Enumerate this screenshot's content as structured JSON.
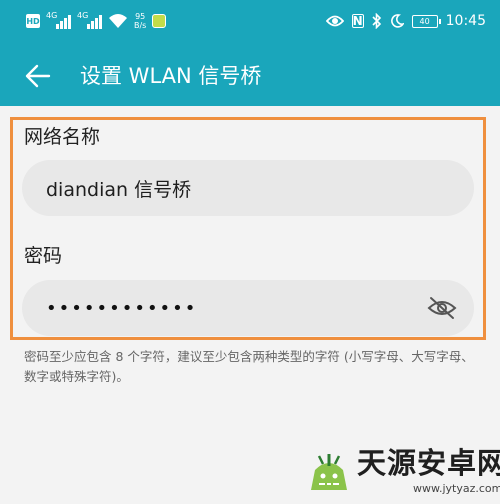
{
  "status_bar": {
    "hd_label": "HD",
    "network_tag_1": "4G",
    "network_tag_2": "4G",
    "speed_value": "95",
    "speed_unit": "B/s",
    "nfc_label": "N",
    "battery_level": "40",
    "time": "10:45"
  },
  "header": {
    "title": "设置 WLAN 信号桥",
    "back_icon": "arrow-left-icon"
  },
  "form": {
    "ssid_label": "网络名称",
    "ssid_value": "diandian 信号桥",
    "password_label": "密码",
    "password_value": "••••••••••••",
    "visibility_icon": "eye-off-icon"
  },
  "hint": "密码至少应包含 8 个字符，建议至少包含两种类型的字符 (小写字母、大写字母、数字或特殊字符)。",
  "watermark": {
    "name": "天源安卓网",
    "url": "www.jytyaz.com"
  },
  "colors": {
    "header_bg": "#1aa6bb",
    "highlight_border": "#ef8f3e",
    "page_bg": "#f3f3f3",
    "input_bg": "#e8e8e8"
  }
}
